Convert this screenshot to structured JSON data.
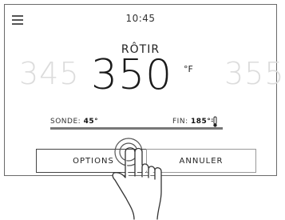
{
  "header": {
    "menu_icon": "hamburger-menu-icon",
    "time": "10:45"
  },
  "cook": {
    "mode": "RÔTIR",
    "temp_prev": "345",
    "temp_current": "350",
    "temp_next": "355",
    "unit": "°F"
  },
  "probe": {
    "probe_label": "SONDE:",
    "probe_value": "45°",
    "end_label": "FIN:",
    "end_value": "185°",
    "end_icon": "thermometer-icon"
  },
  "buttons": {
    "options_label": "OPTIONS",
    "cancel_label": "ANNULER"
  },
  "overlay": {
    "gesture_icon": "tapping-hand-icon"
  }
}
